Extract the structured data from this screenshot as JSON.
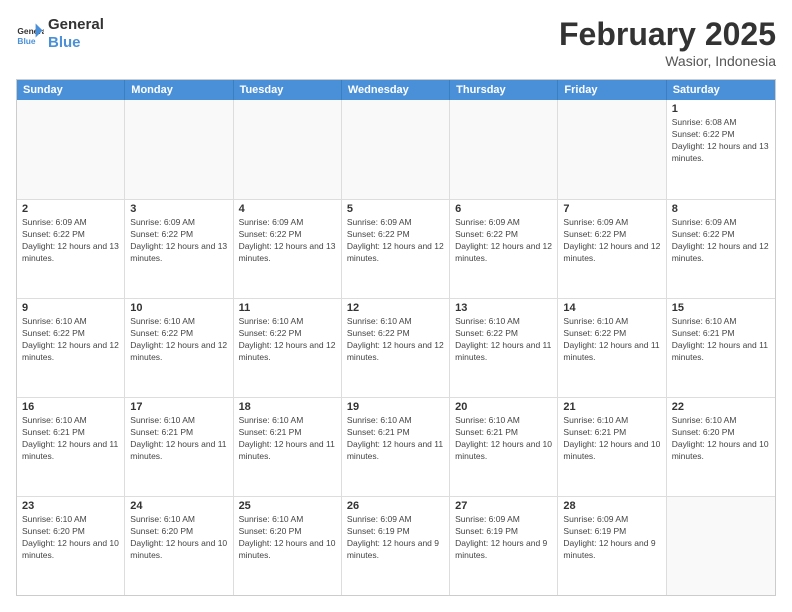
{
  "header": {
    "logo_general": "General",
    "logo_blue": "Blue",
    "month_title": "February 2025",
    "location": "Wasior, Indonesia"
  },
  "weekdays": [
    "Sunday",
    "Monday",
    "Tuesday",
    "Wednesday",
    "Thursday",
    "Friday",
    "Saturday"
  ],
  "weeks": [
    [
      {
        "day": "",
        "info": ""
      },
      {
        "day": "",
        "info": ""
      },
      {
        "day": "",
        "info": ""
      },
      {
        "day": "",
        "info": ""
      },
      {
        "day": "",
        "info": ""
      },
      {
        "day": "",
        "info": ""
      },
      {
        "day": "1",
        "info": "Sunrise: 6:08 AM\nSunset: 6:22 PM\nDaylight: 12 hours and 13 minutes."
      }
    ],
    [
      {
        "day": "2",
        "info": "Sunrise: 6:09 AM\nSunset: 6:22 PM\nDaylight: 12 hours and 13 minutes."
      },
      {
        "day": "3",
        "info": "Sunrise: 6:09 AM\nSunset: 6:22 PM\nDaylight: 12 hours and 13 minutes."
      },
      {
        "day": "4",
        "info": "Sunrise: 6:09 AM\nSunset: 6:22 PM\nDaylight: 12 hours and 13 minutes."
      },
      {
        "day": "5",
        "info": "Sunrise: 6:09 AM\nSunset: 6:22 PM\nDaylight: 12 hours and 12 minutes."
      },
      {
        "day": "6",
        "info": "Sunrise: 6:09 AM\nSunset: 6:22 PM\nDaylight: 12 hours and 12 minutes."
      },
      {
        "day": "7",
        "info": "Sunrise: 6:09 AM\nSunset: 6:22 PM\nDaylight: 12 hours and 12 minutes."
      },
      {
        "day": "8",
        "info": "Sunrise: 6:09 AM\nSunset: 6:22 PM\nDaylight: 12 hours and 12 minutes."
      }
    ],
    [
      {
        "day": "9",
        "info": "Sunrise: 6:10 AM\nSunset: 6:22 PM\nDaylight: 12 hours and 12 minutes."
      },
      {
        "day": "10",
        "info": "Sunrise: 6:10 AM\nSunset: 6:22 PM\nDaylight: 12 hours and 12 minutes."
      },
      {
        "day": "11",
        "info": "Sunrise: 6:10 AM\nSunset: 6:22 PM\nDaylight: 12 hours and 12 minutes."
      },
      {
        "day": "12",
        "info": "Sunrise: 6:10 AM\nSunset: 6:22 PM\nDaylight: 12 hours and 12 minutes."
      },
      {
        "day": "13",
        "info": "Sunrise: 6:10 AM\nSunset: 6:22 PM\nDaylight: 12 hours and 11 minutes."
      },
      {
        "day": "14",
        "info": "Sunrise: 6:10 AM\nSunset: 6:22 PM\nDaylight: 12 hours and 11 minutes."
      },
      {
        "day": "15",
        "info": "Sunrise: 6:10 AM\nSunset: 6:21 PM\nDaylight: 12 hours and 11 minutes."
      }
    ],
    [
      {
        "day": "16",
        "info": "Sunrise: 6:10 AM\nSunset: 6:21 PM\nDaylight: 12 hours and 11 minutes."
      },
      {
        "day": "17",
        "info": "Sunrise: 6:10 AM\nSunset: 6:21 PM\nDaylight: 12 hours and 11 minutes."
      },
      {
        "day": "18",
        "info": "Sunrise: 6:10 AM\nSunset: 6:21 PM\nDaylight: 12 hours and 11 minutes."
      },
      {
        "day": "19",
        "info": "Sunrise: 6:10 AM\nSunset: 6:21 PM\nDaylight: 12 hours and 11 minutes."
      },
      {
        "day": "20",
        "info": "Sunrise: 6:10 AM\nSunset: 6:21 PM\nDaylight: 12 hours and 10 minutes."
      },
      {
        "day": "21",
        "info": "Sunrise: 6:10 AM\nSunset: 6:21 PM\nDaylight: 12 hours and 10 minutes."
      },
      {
        "day": "22",
        "info": "Sunrise: 6:10 AM\nSunset: 6:20 PM\nDaylight: 12 hours and 10 minutes."
      }
    ],
    [
      {
        "day": "23",
        "info": "Sunrise: 6:10 AM\nSunset: 6:20 PM\nDaylight: 12 hours and 10 minutes."
      },
      {
        "day": "24",
        "info": "Sunrise: 6:10 AM\nSunset: 6:20 PM\nDaylight: 12 hours and 10 minutes."
      },
      {
        "day": "25",
        "info": "Sunrise: 6:10 AM\nSunset: 6:20 PM\nDaylight: 12 hours and 10 minutes."
      },
      {
        "day": "26",
        "info": "Sunrise: 6:09 AM\nSunset: 6:19 PM\nDaylight: 12 hours and 9 minutes."
      },
      {
        "day": "27",
        "info": "Sunrise: 6:09 AM\nSunset: 6:19 PM\nDaylight: 12 hours and 9 minutes."
      },
      {
        "day": "28",
        "info": "Sunrise: 6:09 AM\nSunset: 6:19 PM\nDaylight: 12 hours and 9 minutes."
      },
      {
        "day": "",
        "info": ""
      }
    ]
  ]
}
